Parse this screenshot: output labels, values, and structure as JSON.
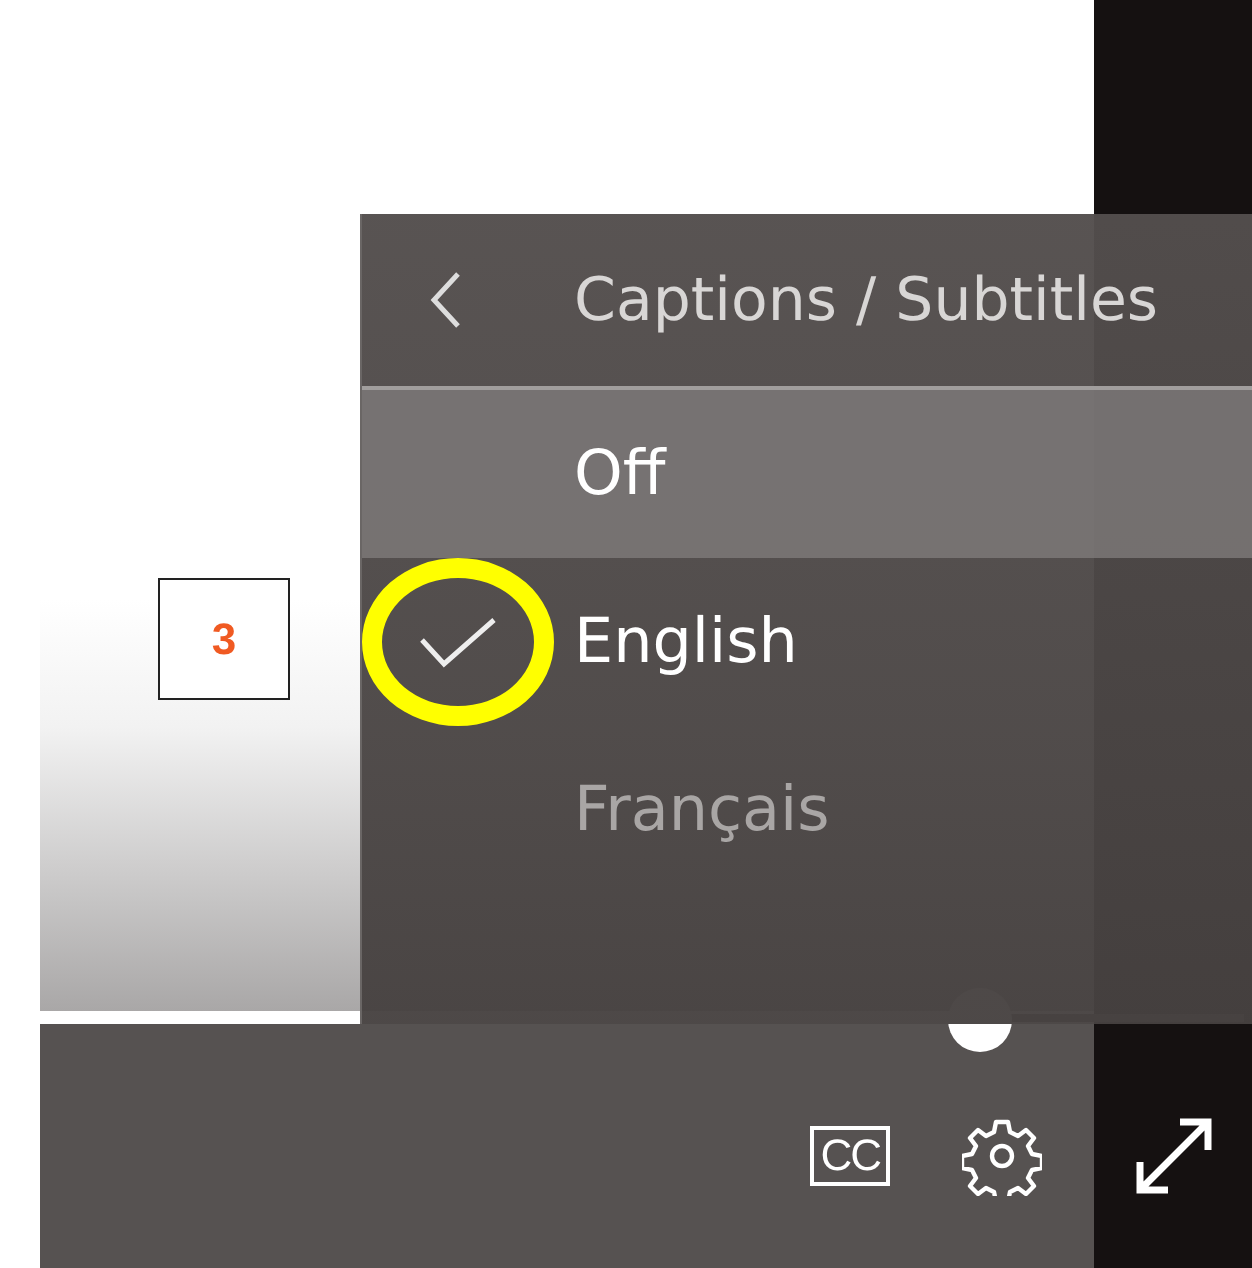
{
  "menu": {
    "title": "Captions / Subtitles",
    "items": [
      {
        "label": "Off",
        "checked": false,
        "hovered": true
      },
      {
        "label": "English",
        "checked": true,
        "hovered": false
      },
      {
        "label": "Français",
        "checked": false,
        "hovered": false
      }
    ]
  },
  "progress": {
    "level": 0.78
  },
  "controls": {
    "captions_label": "CC"
  },
  "annotation": {
    "number": "3"
  }
}
